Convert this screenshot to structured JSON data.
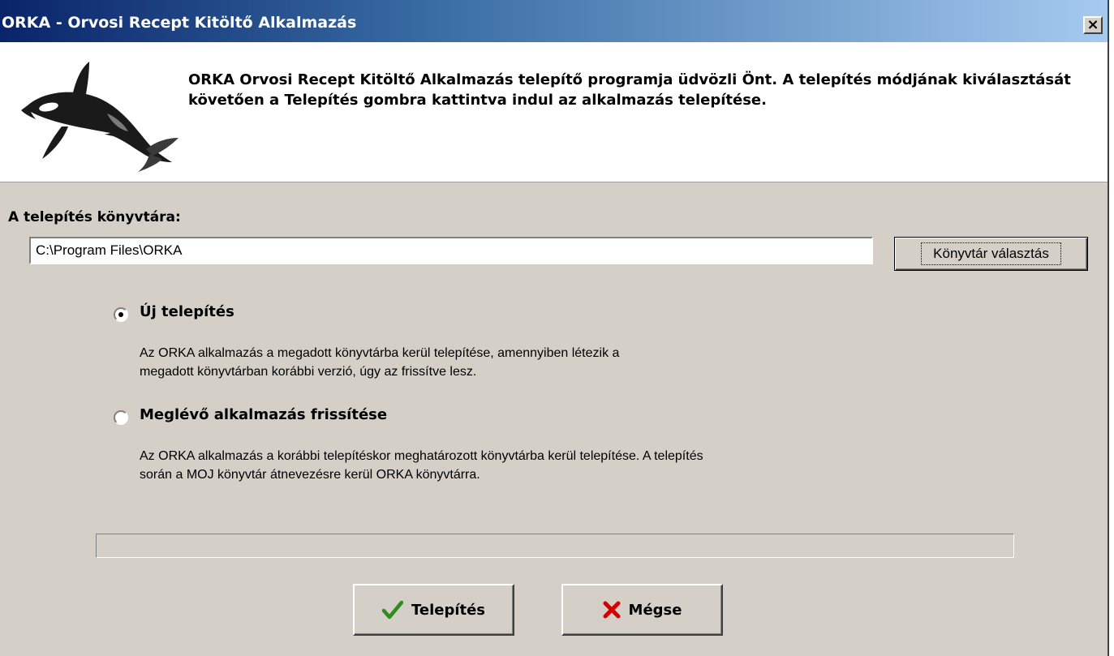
{
  "window": {
    "title": "ORKA - Orvosi Recept Kitöltő Alkalmazás",
    "close_label": "×"
  },
  "header": {
    "welcome_text": "ORKA Orvosi Recept Kitöltő Alkalmazás telepítő programja üdvözli Önt. A telepítés módjának kiválasztását követően a Telepítés gombra kattintva indul az alkalmazás telepítése.",
    "logo_icon": "orca-icon"
  },
  "install_dir": {
    "label": "A telepítés könyvtára:",
    "value": "C:\\Program Files\\ORKA",
    "browse_label": "Könyvtár választás"
  },
  "options": [
    {
      "label": "Új telepítés",
      "selected": true,
      "description_lines": [
        "Az ORKA alkalmazás a megadott könyvtárba kerül telepítése, amennyiben létezik a",
        "megadott könyvtárban korábbi verzió, úgy az frissítve lesz."
      ]
    },
    {
      "label": "Meglévő alkalmazás frissítése",
      "selected": false,
      "description_lines": [
        "Az ORKA alkalmazás a korábbi telepítéskor meghatározott könyvtárba kerül telepítése. A telepítés",
        "során a MOJ könyvtár átnevezésre kerül ORKA könyvtárra."
      ]
    }
  ],
  "progress": {
    "value": 0
  },
  "buttons": {
    "install_label": "Telepítés",
    "install_icon": "checkmark-icon",
    "cancel_label": "Mégse",
    "cancel_icon": "x-mark-icon"
  },
  "colors": {
    "title_gradient_start": "#0a246a",
    "title_gradient_end": "#a6caf0",
    "dialog_face": "#d4d0c8",
    "check_green": "#2e8b1e",
    "cancel_red": "#d40000"
  }
}
